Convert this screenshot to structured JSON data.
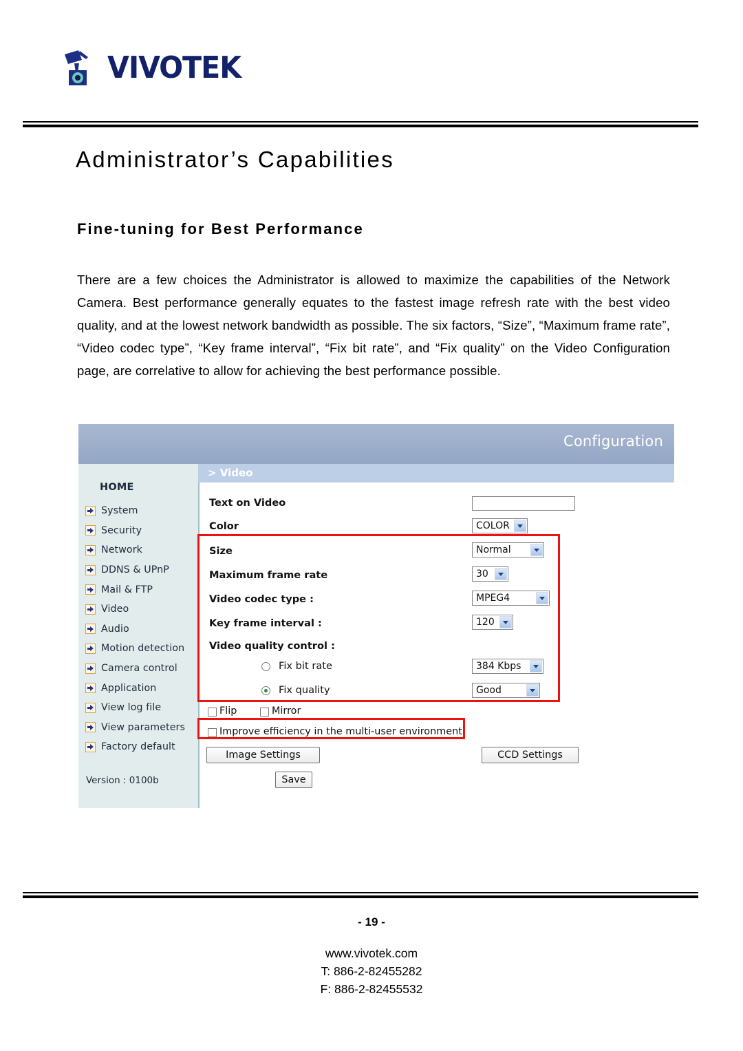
{
  "brand": {
    "logo_text": "VIVOTEK",
    "logo_icon": "camera-icon"
  },
  "document": {
    "page_title": "Administrator’s Capabilities",
    "section_title": "Fine-tuning for Best Performance",
    "paragraph": "There are a few choices the Administrator is allowed to maximize the capabilities of the Network Camera. Best performance generally equates to the fastest image refresh rate with the best video quality, and at the lowest network bandwidth as possible. The six factors, “Size”, “Maximum frame rate”, “Video codec type”, “Key frame interval”, “Fix bit rate”, and “Fix quality” on the Video Configuration page, are correlative to allow for achieving the best performance possible."
  },
  "screenshot": {
    "header_title": "Configuration",
    "breadcrumb": "> Video",
    "sidebar": {
      "home_label": "HOME",
      "items": [
        {
          "label": "System"
        },
        {
          "label": "Security"
        },
        {
          "label": "Network"
        },
        {
          "label": "DDNS & UPnP"
        },
        {
          "label": "Mail & FTP"
        },
        {
          "label": "Video"
        },
        {
          "label": "Audio"
        },
        {
          "label": "Motion detection"
        },
        {
          "label": "Camera control"
        },
        {
          "label": "Application"
        },
        {
          "label": "View log file"
        },
        {
          "label": "View parameters"
        },
        {
          "label": "Factory default"
        }
      ],
      "version": "Version : 0100b"
    },
    "form": {
      "text_on_video": {
        "label": "Text on Video",
        "value": ""
      },
      "color": {
        "label": "Color",
        "value": "COLOR"
      },
      "size": {
        "label": "Size",
        "value": "Normal"
      },
      "max_frame_rate": {
        "label": "Maximum frame rate",
        "value": "30"
      },
      "video_codec_type": {
        "label": "Video codec type :",
        "value": "MPEG4"
      },
      "key_frame_interval": {
        "label": "Key frame interval :",
        "value": "120"
      },
      "video_quality_control": {
        "label": "Video quality control :"
      },
      "fix_bit_rate": {
        "label": "Fix bit rate",
        "value": "384 Kbps",
        "selected": false
      },
      "fix_quality": {
        "label": "Fix quality",
        "value": "Good",
        "selected": true
      },
      "flip": {
        "label": "Flip",
        "checked": false
      },
      "mirror": {
        "label": "Mirror",
        "checked": false
      },
      "improve_efficiency": {
        "label": "Improve efficiency in the multi-user environment",
        "checked": false
      },
      "image_settings_button": "Image Settings",
      "ccd_settings_button": "CCD Settings",
      "save_button": "Save"
    },
    "colors": {
      "header_bar": "#93a6c4",
      "breadcrumb_bar": "#bdcfe7",
      "sidebar_bg": "#e2ecec",
      "highlight": "#ee1111"
    }
  },
  "footer": {
    "page_number": "- 19 -",
    "website": "www.vivotek.com",
    "phone": "T: 886-2-82455282",
    "fax": "F: 886-2-82455532"
  }
}
